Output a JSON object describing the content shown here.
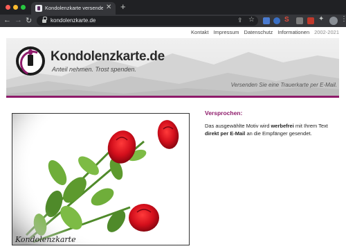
{
  "browser": {
    "tab_title": "Kondolenzkarte versenden | Ko",
    "tab_close": "✕",
    "new_tab": "+",
    "url": "kondolenzkarte.de",
    "back": "←",
    "forward": "→",
    "reload": "↻",
    "share": "⇪",
    "star": "☆",
    "extension_s": "S",
    "puzzle": "✦",
    "menu": "⋮"
  },
  "topnav": {
    "items": [
      "Kontakt",
      "Impressum",
      "Datenschutz",
      "Informationen"
    ],
    "years": "2002-2021"
  },
  "banner": {
    "brand": "Kondolenzkarte.de",
    "slogan": "Anteil nehmen. Trost spenden.",
    "tagline": "Versenden Sie eine Trauerkarte per E-Mail."
  },
  "photo": {
    "caption": "Kondolenzkarte"
  },
  "content": {
    "heading": "Versprochen:",
    "text_1": "Das ausgewählte Motiv wird ",
    "bold_1": "werbefrei",
    "text_2": " mit Ihrem Text ",
    "bold_2": "direkt per E-Mail",
    "text_3": " an die Empfänger gesendet."
  },
  "colors": {
    "accent": "#8e1a6a",
    "chrome_dark": "#202124",
    "chrome_toolbar": "#35363a"
  }
}
